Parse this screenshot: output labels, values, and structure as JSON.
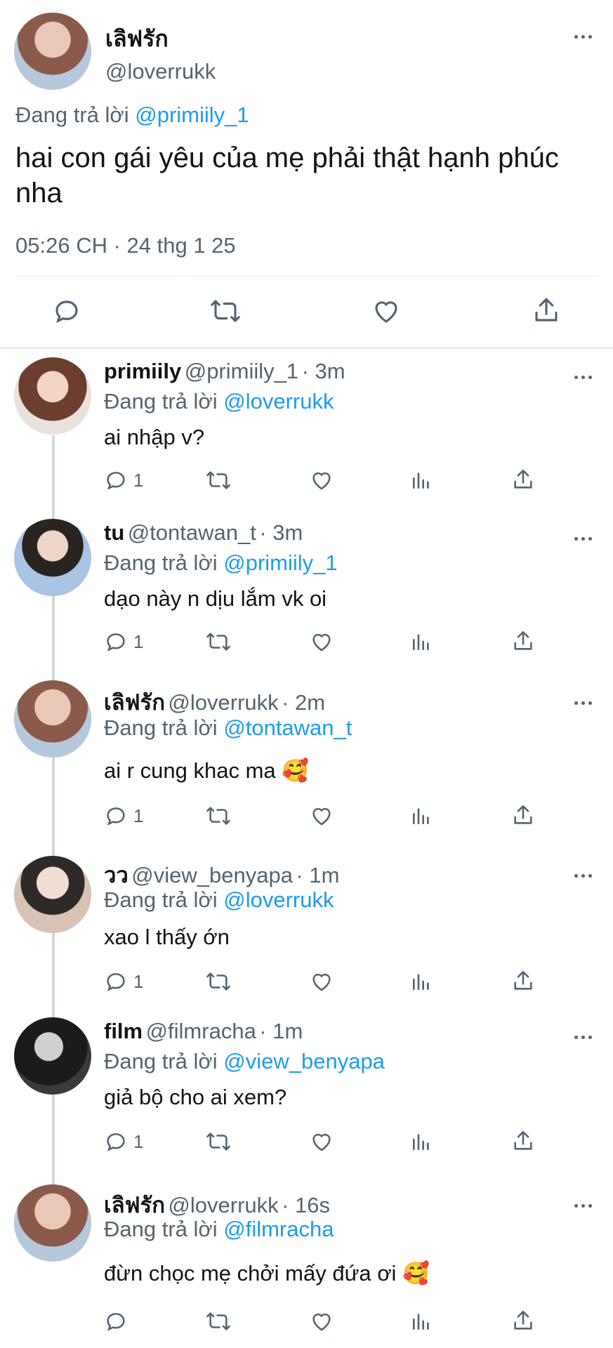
{
  "main_tweet": {
    "display_name": "เลิฟรัก",
    "handle": "@loverrukk",
    "replying_label": "Đang trả lời",
    "replying_to": "@primiily_1",
    "text": "hai con gái yêu của mẹ phải thật hạnh phúc nha",
    "timestamp": "05:26 CH · 24 thg 1 25"
  },
  "replies": [
    {
      "name": "primiily",
      "handle": "@primiily_1",
      "time": "· 3m",
      "replying_label": "Đang trả lời",
      "replying_to": "@loverrukk",
      "text": "ai nhập v?",
      "reply_count": "1",
      "avatar_color": "#c8a48a"
    },
    {
      "name": "tu",
      "handle": "@tontawan_t",
      "time": "· 3m",
      "replying_label": "Đang trả lời",
      "replying_to": "@primiily_1",
      "text": "dạo này n dịu lắm vk oi",
      "reply_count": "1",
      "avatar_color": "#9fb7d6"
    },
    {
      "name": "เลิฟรัก",
      "handle": "@loverrukk",
      "time": "· 2m",
      "replying_label": "Đang trả lời",
      "replying_to": "@tontawan_t",
      "text": "ai r cung khac ma 🥰",
      "reply_count": "1",
      "avatar_color": "#b98a7a"
    },
    {
      "name": "วว",
      "handle": "@view_benyapa",
      "time": "· 1m",
      "replying_label": "Đang trả lời",
      "replying_to": "@loverrukk",
      "text": "xao l thấy ớn",
      "reply_count": "1",
      "avatar_color": "#d8c3b4"
    },
    {
      "name": "film",
      "handle": "@filmracha",
      "time": "· 1m",
      "replying_label": "Đang trả lời",
      "replying_to": "@view_benyapa",
      "text": "giả bộ cho ai xem?",
      "reply_count": "1",
      "avatar_color": "#2b2b2b"
    },
    {
      "name": "เลิฟรัก",
      "handle": "@loverrukk",
      "time": "· 16s",
      "replying_label": "Đang trả lời",
      "replying_to": "@filmracha",
      "text": "đừn chọc mẹ chởi mấy đứa ơi 🥰",
      "reply_count": "",
      "avatar_color": "#b98a7a"
    }
  ],
  "icons": {
    "reply": "reply-icon",
    "retweet": "retweet-icon",
    "like": "heart-icon",
    "views": "views-icon",
    "share": "share-icon",
    "more": "more-icon"
  },
  "colors": {
    "link": "#1d9bf0",
    "muted": "#536471",
    "text": "#0f1419",
    "divider": "#e1e8ed",
    "thread_line": "#cfd9de"
  }
}
